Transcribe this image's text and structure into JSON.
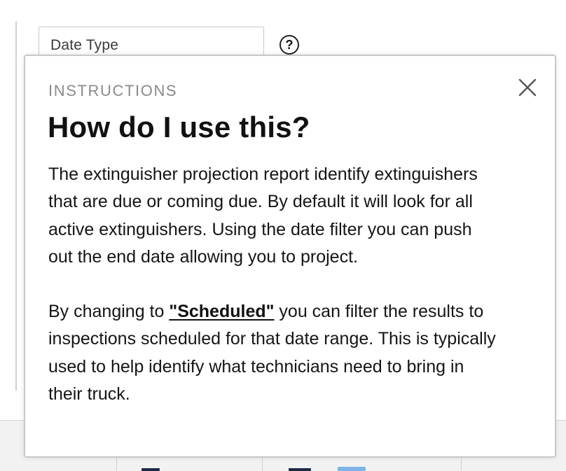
{
  "background": {
    "date_type_label": "Date Type",
    "help_button_label": "?"
  },
  "modal": {
    "eyebrow": "INSTRUCTIONS",
    "title": "How do I use this?",
    "paragraph1": "The extinguisher projection report identify extinguishers that are due or coming due. By default it will look for all active extinguishers. Using the date filter you can push out the end date allowing you to project.",
    "paragraph2_before": "By changing to ",
    "paragraph2_link": "\"Scheduled\"",
    "paragraph2_after": " you can filter the results to inspections scheduled for that date range. This is typically used to help identify what technicians need to bring in their truck."
  },
  "icons": {
    "close": "close-icon",
    "help": "question-circle-icon"
  },
  "colors": {
    "modal_border": "#c8c8c8",
    "eyebrow": "#8a8a8a",
    "text": "#111111",
    "footer_bg": "#f2f2f2"
  }
}
